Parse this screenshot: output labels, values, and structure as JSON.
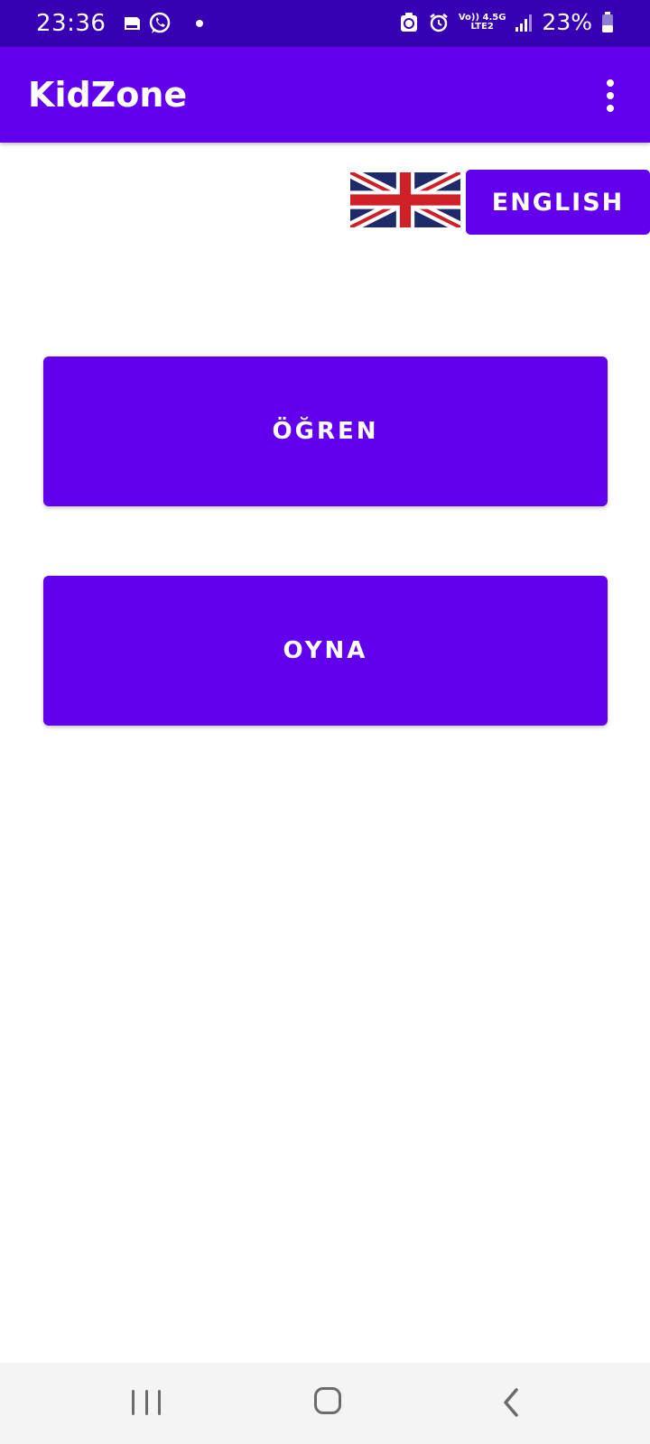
{
  "status_bar": {
    "time": "23:36",
    "battery": "23%",
    "network_top": "Vo)) 4.5G",
    "network_bottom": "LTE2",
    "icons": [
      "sim-card-icon",
      "whatsapp-icon",
      "notification-dot",
      "recycle-icon",
      "alarm-icon",
      "network-type-icon",
      "signal-icon",
      "battery-icon"
    ]
  },
  "app_bar": {
    "title": "KidZone",
    "menu_icon": "more-vert-icon"
  },
  "language": {
    "flag_icon": "uk-flag-icon",
    "button_label": "ENGLISH"
  },
  "main": {
    "learn_label": "ÖĞREN",
    "play_label": "OYNA"
  },
  "nav_bar": {
    "icons": [
      "recent-apps-icon",
      "home-icon",
      "back-icon"
    ]
  },
  "colors": {
    "status_bar": "#3700b3",
    "primary": "#6200ee",
    "on_primary": "#ffffff",
    "background": "#ffffff",
    "nav_bar": "#f4f4f4",
    "flag_blue": "#1f2a6b",
    "flag_red": "#cf2027"
  }
}
